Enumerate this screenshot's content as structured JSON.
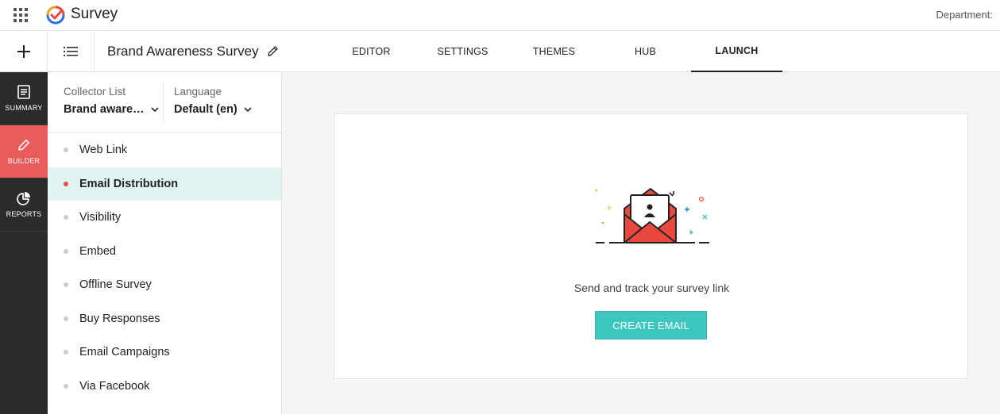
{
  "app": {
    "title": "Survey",
    "department_label": "Department:"
  },
  "survey": {
    "title": "Brand Awareness Survey"
  },
  "tabs": [
    {
      "label": "EDITOR"
    },
    {
      "label": "SETTINGS"
    },
    {
      "label": "THEMES"
    },
    {
      "label": "HUB"
    },
    {
      "label": "LAUNCH",
      "active": true
    }
  ],
  "rail": [
    {
      "label": "SUMMARY",
      "icon": "document-icon"
    },
    {
      "label": "BUILDER",
      "icon": "pencil-icon",
      "active": true
    },
    {
      "label": "REPORTS",
      "icon": "pie-chart-icon"
    }
  ],
  "panel": {
    "collector_label": "Collector List",
    "collector_value": "Brand aware…",
    "language_label": "Language",
    "language_value": "Default (en)",
    "items": [
      {
        "label": "Web Link"
      },
      {
        "label": "Email Distribution",
        "active": true
      },
      {
        "label": "Visibility"
      },
      {
        "label": "Embed"
      },
      {
        "label": "Offline Survey"
      },
      {
        "label": "Buy Responses"
      },
      {
        "label": "Email Campaigns"
      },
      {
        "label": "Via Facebook"
      }
    ]
  },
  "main": {
    "message": "Send and track your survey link",
    "button_label": "CREATE EMAIL"
  },
  "colors": {
    "accent": "#3ec7c0",
    "rail_bg": "#2b2b2b",
    "rail_active": "#ea5b5b",
    "active_item_bg": "#e3f5f3",
    "envelope_red": "#e8493f"
  }
}
